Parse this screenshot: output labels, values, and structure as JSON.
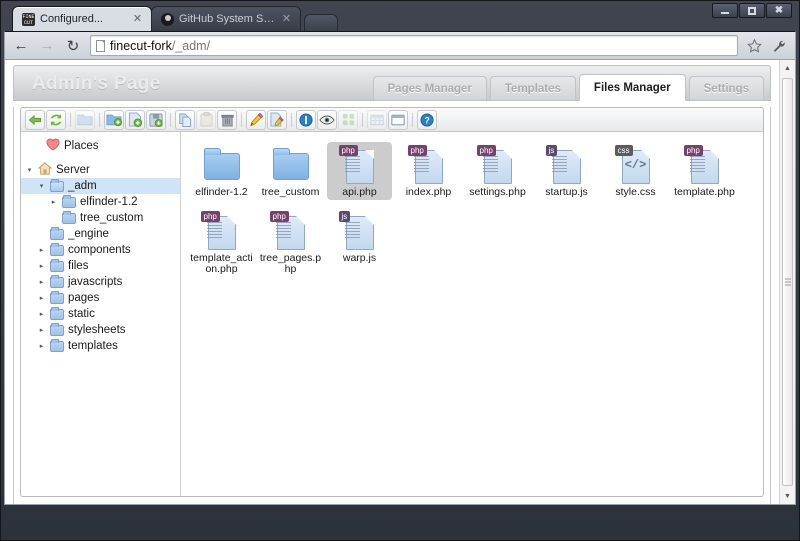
{
  "browser": {
    "window_controls": [
      "minimize",
      "maximize",
      "close"
    ],
    "tabs": [
      {
        "title": "Configured...",
        "favicon": "finecut-icon",
        "active": true
      },
      {
        "title": "GitHub System Status",
        "favicon": "github-icon",
        "active": false
      }
    ],
    "new_tab_label": "",
    "nav": {
      "back": "←",
      "forward": "→",
      "reload": "↻",
      "url_host": "finecut-fork",
      "url_path": "/_adm/",
      "bookmark": "☆",
      "menu": "wrench-icon"
    }
  },
  "page": {
    "title": "Admin's Page",
    "tabs": [
      {
        "label": "Pages Manager",
        "active": false
      },
      {
        "label": "Templates",
        "active": false
      },
      {
        "label": "Files Manager",
        "active": true
      },
      {
        "label": "Settings",
        "active": false
      }
    ]
  },
  "filemanager": {
    "toolbar": [
      {
        "name": "back-button",
        "icon": "arrow-left-green",
        "disabled": false
      },
      {
        "name": "reload-button",
        "icon": "refresh-green",
        "disabled": false
      },
      {
        "sep": true
      },
      {
        "name": "open-folder-button",
        "icon": "folder-open",
        "disabled": true
      },
      {
        "sep": true
      },
      {
        "name": "new-folder-button",
        "icon": "folder-add",
        "disabled": false
      },
      {
        "name": "new-file-button",
        "icon": "file-add",
        "disabled": false
      },
      {
        "name": "upload-button",
        "icon": "save-disk-add",
        "disabled": false
      },
      {
        "sep": true
      },
      {
        "name": "copy-button",
        "icon": "copy-pages",
        "disabled": false
      },
      {
        "name": "paste-button",
        "icon": "paste-clipboard",
        "disabled": true
      },
      {
        "name": "delete-button",
        "icon": "trash-bin",
        "disabled": false
      },
      {
        "sep": true
      },
      {
        "name": "rename-button",
        "icon": "pencil",
        "disabled": false
      },
      {
        "name": "edit-button",
        "icon": "file-edit-pencil",
        "disabled": false
      },
      {
        "sep": true
      },
      {
        "name": "info-button",
        "icon": "info-circle",
        "disabled": false
      },
      {
        "name": "preview-button",
        "icon": "eye",
        "disabled": false
      },
      {
        "name": "icons-view-button",
        "icon": "grid-squares",
        "disabled": true
      },
      {
        "sep": true
      },
      {
        "name": "list-view-button",
        "icon": "table-list",
        "disabled": true
      },
      {
        "name": "details-view-button",
        "icon": "window-details",
        "disabled": false
      },
      {
        "sep": true
      },
      {
        "name": "help-button",
        "icon": "question-circle",
        "disabled": false
      }
    ],
    "tree": [
      {
        "label": "Places",
        "icon": "heart-places-icon",
        "indent": 0,
        "twisty": "none",
        "selected": false,
        "type": "places"
      },
      {
        "label": "Server",
        "icon": "home-icon",
        "indent": 0,
        "twisty": "open",
        "selected": false,
        "type": "root"
      },
      {
        "label": "_adm",
        "icon": "folder-open-icon",
        "indent": 1,
        "twisty": "open",
        "selected": true,
        "type": "folder"
      },
      {
        "label": "elfinder-1.2",
        "icon": "folder-icon",
        "indent": 2,
        "twisty": "closed",
        "selected": false,
        "type": "folder"
      },
      {
        "label": "tree_custom",
        "icon": "folder-icon",
        "indent": 2,
        "twisty": "none",
        "selected": false,
        "type": "folder"
      },
      {
        "label": "_engine",
        "icon": "folder-icon",
        "indent": 1,
        "twisty": "none",
        "selected": false,
        "type": "folder"
      },
      {
        "label": "components",
        "icon": "folder-icon",
        "indent": 1,
        "twisty": "closed",
        "selected": false,
        "type": "folder"
      },
      {
        "label": "files",
        "icon": "folder-icon",
        "indent": 1,
        "twisty": "closed",
        "selected": false,
        "type": "folder"
      },
      {
        "label": "javascripts",
        "icon": "folder-icon",
        "indent": 1,
        "twisty": "closed",
        "selected": false,
        "type": "folder"
      },
      {
        "label": "pages",
        "icon": "folder-icon",
        "indent": 1,
        "twisty": "closed",
        "selected": false,
        "type": "folder"
      },
      {
        "label": "static",
        "icon": "folder-icon",
        "indent": 1,
        "twisty": "closed",
        "selected": false,
        "type": "folder"
      },
      {
        "label": "stylesheets",
        "icon": "folder-icon",
        "indent": 1,
        "twisty": "closed",
        "selected": false,
        "type": "folder"
      },
      {
        "label": "templates",
        "icon": "folder-icon",
        "indent": 1,
        "twisty": "closed",
        "selected": false,
        "type": "folder"
      }
    ],
    "files": [
      {
        "name": "elfinder-1.2",
        "kind": "folder",
        "badge": "",
        "selected": false
      },
      {
        "name": "tree_custom",
        "kind": "folder",
        "badge": "",
        "selected": false
      },
      {
        "name": "api.php",
        "kind": "file",
        "badge": "php",
        "selected": true
      },
      {
        "name": "index.php",
        "kind": "file",
        "badge": "php",
        "selected": false
      },
      {
        "name": "settings.php",
        "kind": "file",
        "badge": "php",
        "selected": false
      },
      {
        "name": "startup.js",
        "kind": "file",
        "badge": "js",
        "selected": false
      },
      {
        "name": "style.css",
        "kind": "code",
        "badge": "css",
        "selected": false
      },
      {
        "name": "template.php",
        "kind": "file",
        "badge": "php",
        "selected": false
      },
      {
        "name": "template_action.php",
        "kind": "file",
        "badge": "php",
        "selected": false
      },
      {
        "name": "tree_pages.php",
        "kind": "file",
        "badge": "php",
        "selected": false
      },
      {
        "name": "warp.js",
        "kind": "file",
        "badge": "js",
        "selected": false
      }
    ]
  },
  "colors": {
    "selection": "#cfe4f7",
    "file_selection": "#cccccc",
    "php_badge": "#76416b",
    "js_badge": "#5a4a6b",
    "css_badge": "#5b5b5b",
    "folder": "#9ec2ea"
  }
}
